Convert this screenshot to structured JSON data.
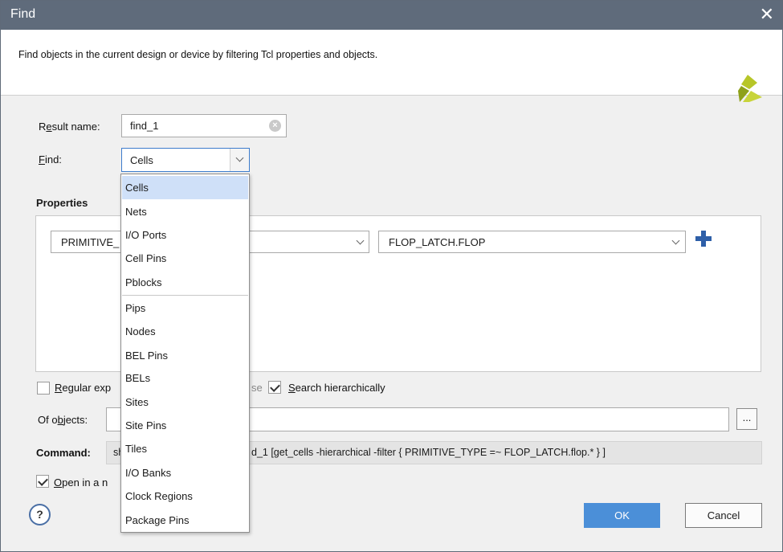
{
  "window": {
    "title": "Find",
    "close_icon": "close-icon"
  },
  "header": {
    "description": "Find objects in the current design or device by filtering Tcl properties and objects."
  },
  "form": {
    "result_name": {
      "label_pre": "R",
      "label_u": "e",
      "label_post": "sult name:",
      "value": "find_1"
    },
    "find": {
      "label_u": "F",
      "label_post": "ind:",
      "value": "Cells"
    }
  },
  "properties": {
    "title": "Properties",
    "property_value": "PRIMITIVE_",
    "value_value": "FLOP_LATCH.FLOP"
  },
  "options": {
    "regular_expression": {
      "label_u": "R",
      "label_post": "egular exp",
      "checked": false
    },
    "match_case_partial": "se",
    "search_hierarchically": {
      "label_u": "S",
      "label_post": "earch hierarchically",
      "checked": true
    }
  },
  "of_objects": {
    "label_pre": "Of o",
    "label_u": "b",
    "label_post": "jects:",
    "value": "",
    "browse_label": "..."
  },
  "command": {
    "label": "Command:",
    "text_start": "sh",
    "text_end": "d_1 [get_cells -hierarchical -filter { PRIMITIVE_TYPE =~ FLOP_LATCH.flop.* } ]"
  },
  "open_in_new": {
    "label_u": "O",
    "label_post": "pen in a n",
    "checked": true
  },
  "buttons": {
    "help": "?",
    "ok": "OK",
    "cancel": "Cancel"
  },
  "dropdown": {
    "items": [
      "Cells",
      "Nets",
      "I/O Ports",
      "Cell Pins",
      "Pblocks",
      "Pips",
      "Nodes",
      "BEL Pins",
      "BELs",
      "Sites",
      "Site Pins",
      "Tiles",
      "I/O Banks",
      "Clock Regions",
      "Package Pins"
    ],
    "selected": "Cells"
  },
  "colors": {
    "titlebar": "#5f6b7b",
    "accent": "#4b8fd8",
    "selected_item": "#cfe0f8",
    "logo": "#a6b81e"
  }
}
